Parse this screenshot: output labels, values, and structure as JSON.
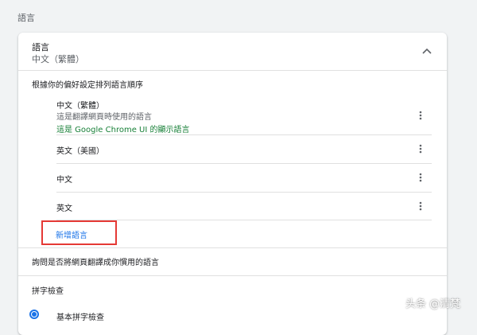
{
  "section": {
    "title": "語言"
  },
  "languages_card": {
    "title": "語言",
    "current_language": "中文（繁體）",
    "collapse_icon": "chevron-up-icon",
    "order_label": "根據你的偏好設定排列語言順序",
    "items": [
      {
        "name": "中文（繁體）",
        "desc": "這是翻譯網頁時使用的語言",
        "note": "這是 Google Chrome UI 的顯示語言"
      },
      {
        "name": "英文（美國）"
      },
      {
        "name": "中文"
      },
      {
        "name": "英文"
      }
    ],
    "more_icon": "more-vert-icon",
    "add_language": "新增語言",
    "highlight_color": "#e53935",
    "note_color": "#188038",
    "link_color": "#1a73e8",
    "ask_translate_label": "詢問是否將網頁翻譯成你慣用的語言"
  },
  "spellcheck": {
    "title": "拼字檢查",
    "basic_label": "基本拼字檢查"
  },
  "watermark": {
    "text": "头条 @清梵"
  }
}
